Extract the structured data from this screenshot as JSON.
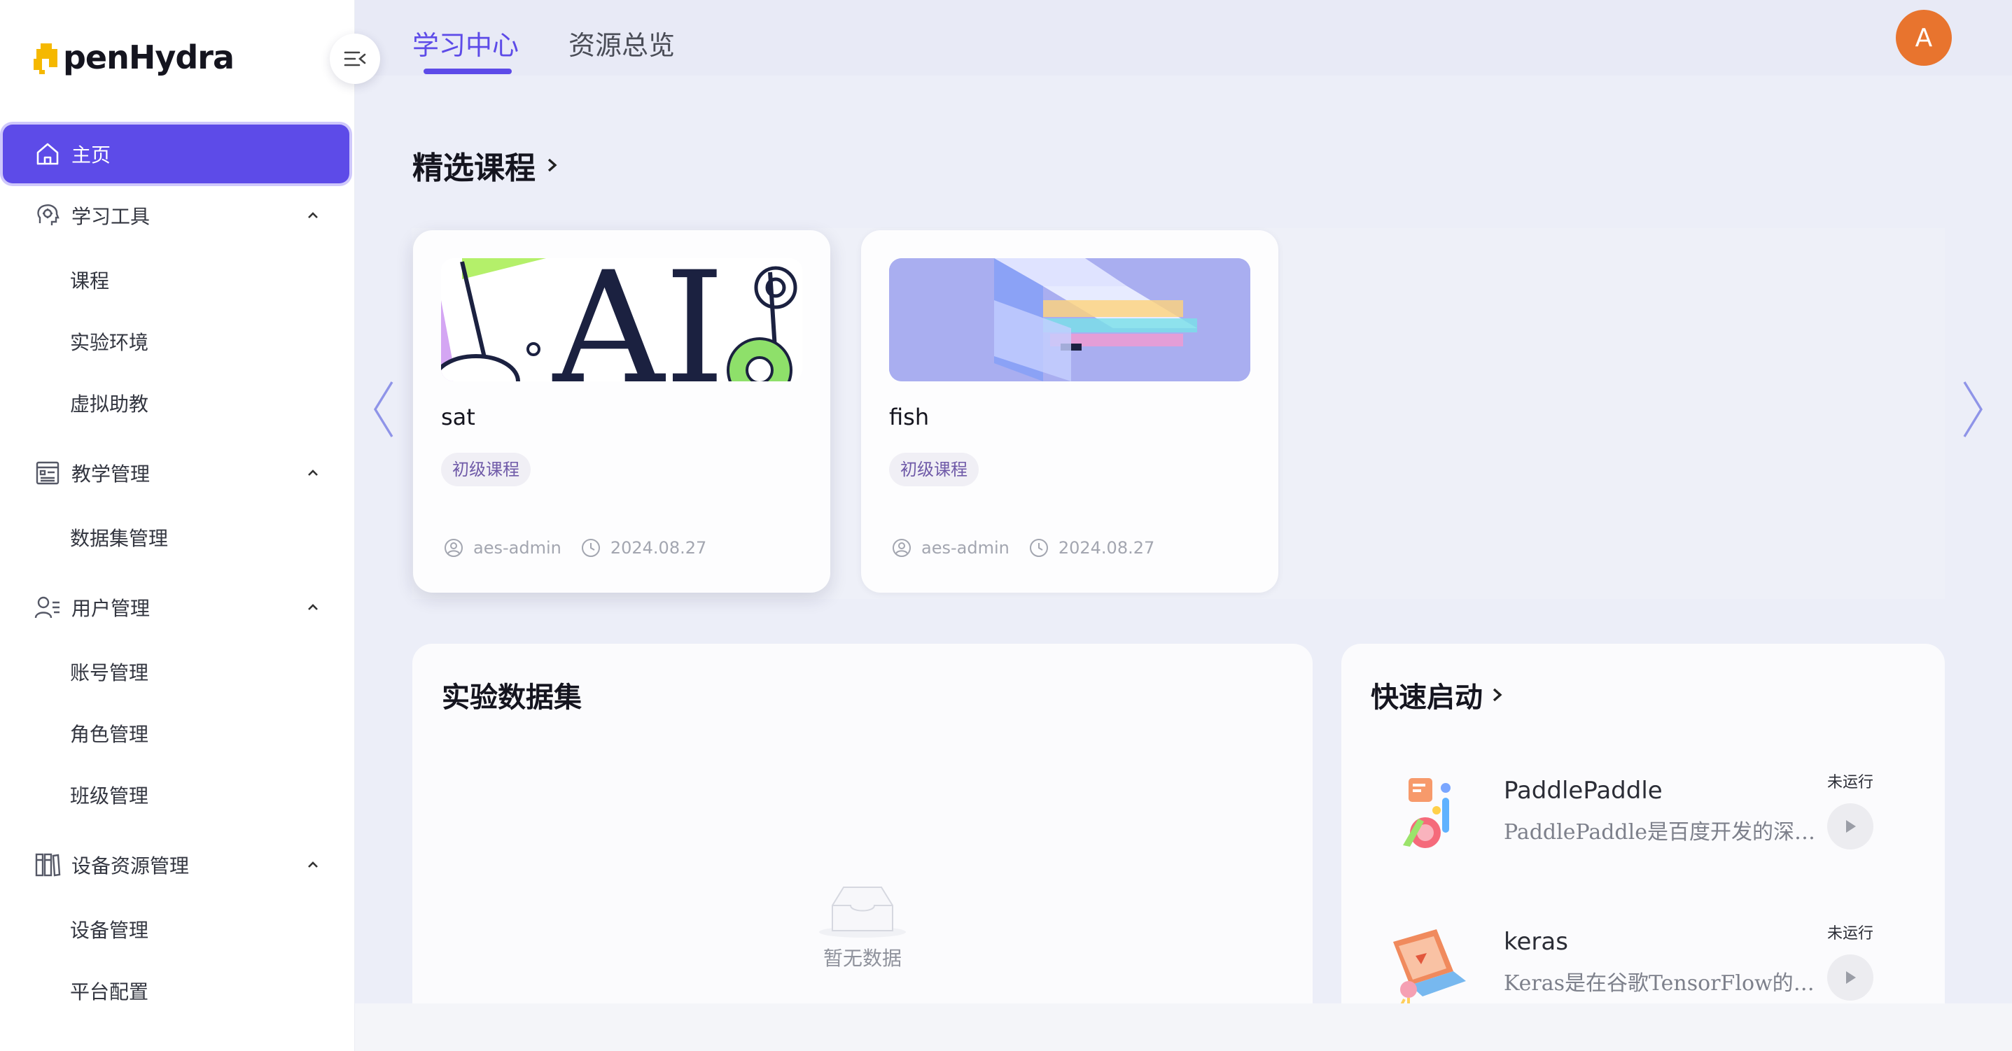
{
  "brand": {
    "logo_text": "penHydra",
    "accent_color": "#5d4be8"
  },
  "header": {
    "tabs": [
      {
        "label": "学习中心",
        "active": true
      },
      {
        "label": "资源总览",
        "active": false
      }
    ],
    "avatar_initial": "A"
  },
  "sidebar": {
    "items": [
      {
        "label": "主页",
        "icon": "home-icon",
        "active": true
      },
      {
        "label": "学习工具",
        "icon": "brain-bulb-icon",
        "expanded": true,
        "children": [
          "课程",
          "实验环境",
          "虚拟助教"
        ]
      },
      {
        "label": "教学管理",
        "icon": "document-list-icon",
        "expanded": true,
        "children": [
          "数据集管理"
        ]
      },
      {
        "label": "用户管理",
        "icon": "user-list-icon",
        "expanded": true,
        "children": [
          "账号管理",
          "角色管理",
          "班级管理"
        ]
      },
      {
        "label": "设备资源管理",
        "icon": "books-icon",
        "expanded": true,
        "children": [
          "设备管理",
          "平台配置"
        ]
      }
    ]
  },
  "featured": {
    "title": "精选课程",
    "courses": [
      {
        "name": "sat",
        "tag": "初级课程",
        "author": "aes-admin",
        "date": "2024.08.27"
      },
      {
        "name": "fish",
        "tag": "初级课程",
        "author": "aes-admin",
        "date": "2024.08.27"
      }
    ]
  },
  "datasets": {
    "title": "实验数据集",
    "empty_text": "暂无数据"
  },
  "quickstart": {
    "title": "快速启动",
    "items": [
      {
        "name": "PaddlePaddle",
        "desc": "PaddlePaddle是百度开发的深度学...",
        "status": "未运行"
      },
      {
        "name": "keras",
        "desc": "Keras是在谷歌TensorFlow的基础...",
        "status": "未运行"
      }
    ]
  }
}
